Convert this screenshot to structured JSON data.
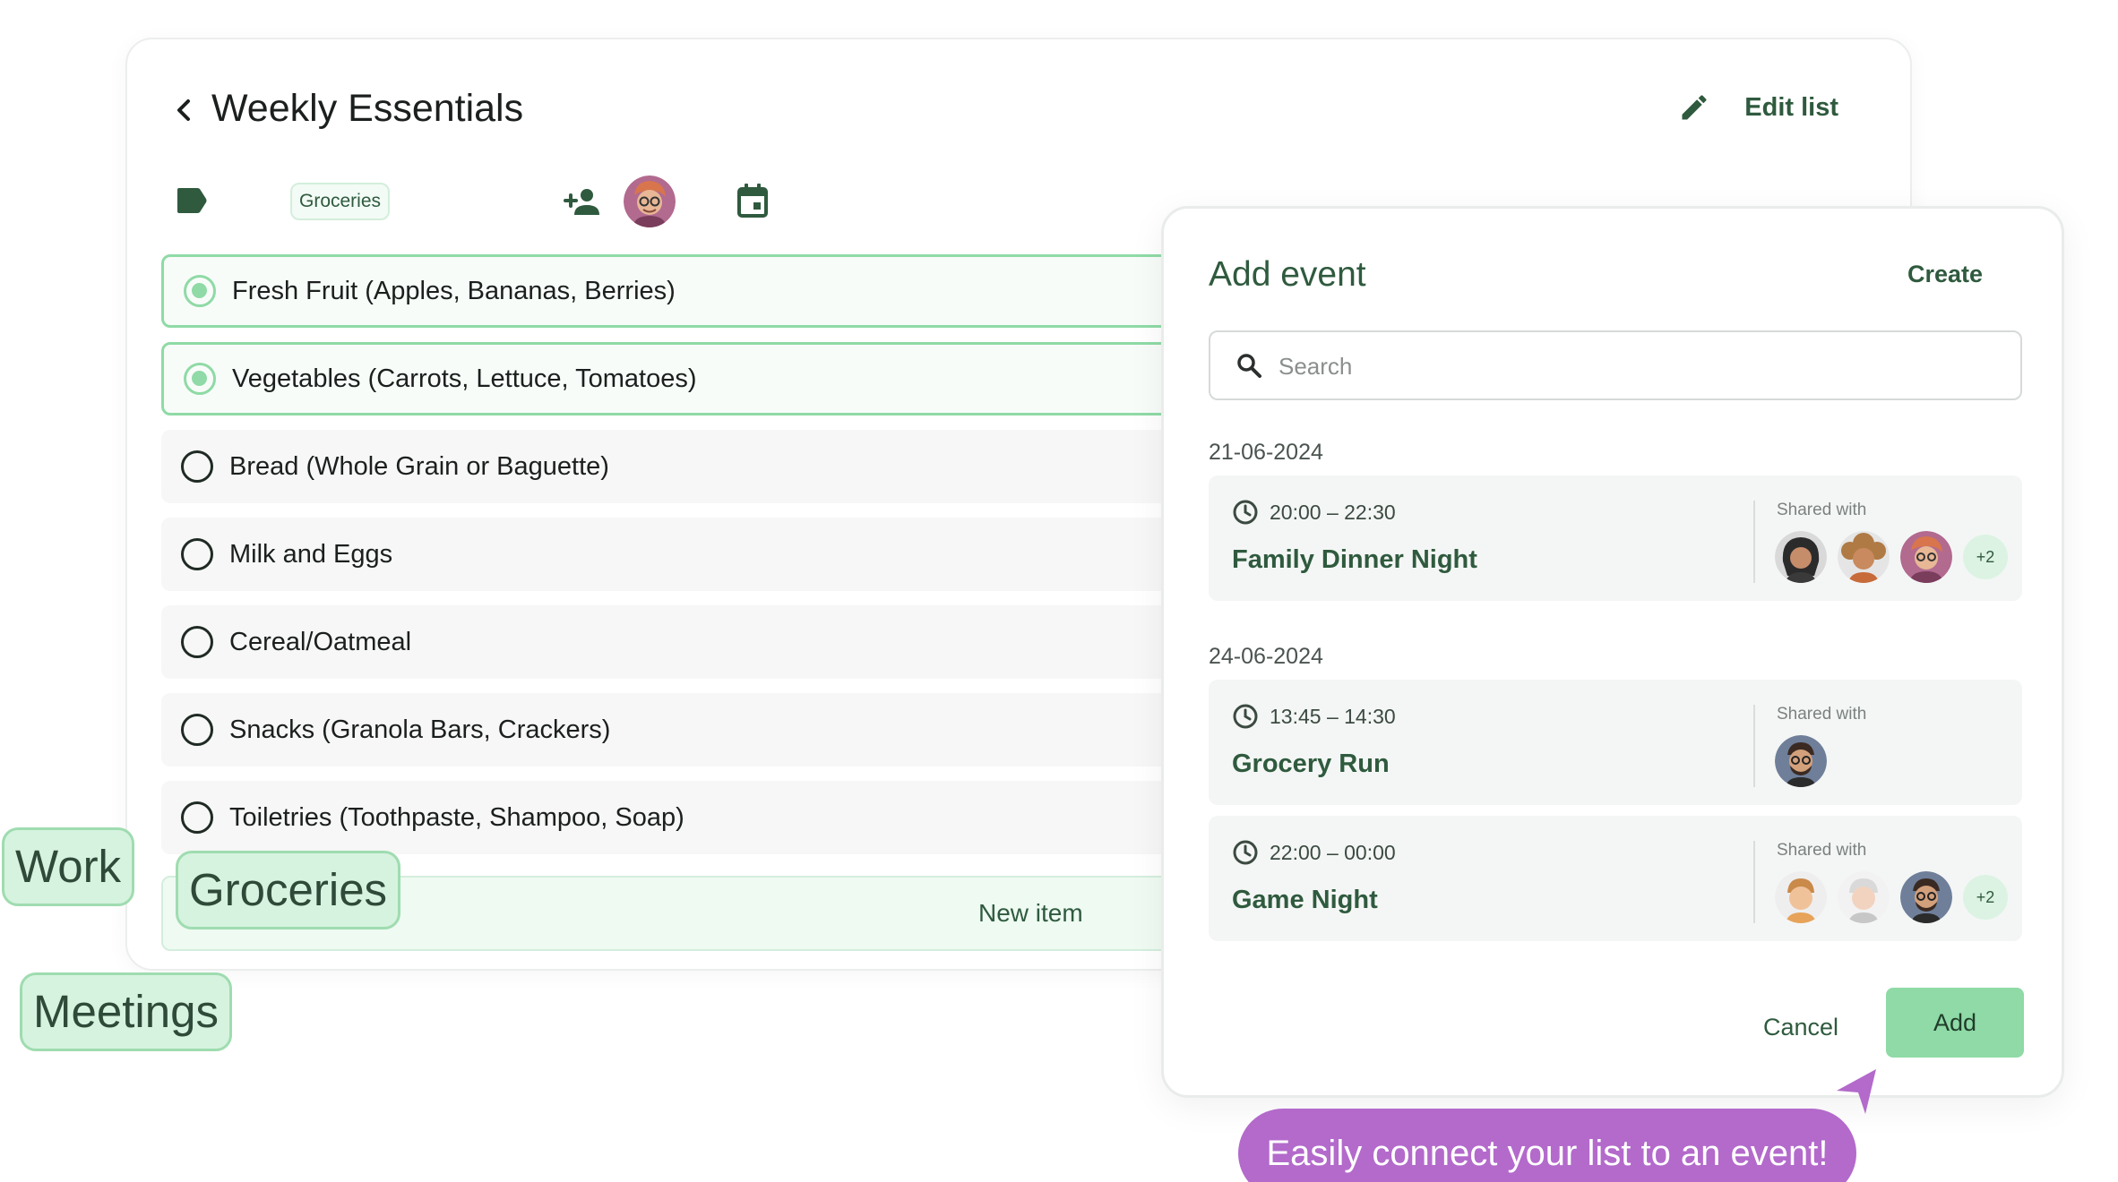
{
  "list": {
    "title": "Weekly Essentials",
    "edit_label": "Edit list",
    "tag": "Groceries",
    "items": [
      {
        "label": "Fresh Fruit (Apples, Bananas, Berries)",
        "checked": true
      },
      {
        "label": "Vegetables (Carrots, Lettuce, Tomatoes)",
        "checked": true
      },
      {
        "label": "Bread (Whole Grain or Baguette)",
        "checked": false
      },
      {
        "label": "Milk and Eggs",
        "checked": false
      },
      {
        "label": "Cereal/Oatmeal",
        "checked": false
      },
      {
        "label": "Snacks (Granola Bars, Crackers)",
        "checked": false
      },
      {
        "label": "Toiletries (Toothpaste, Shampoo, Soap)",
        "checked": false
      }
    ],
    "new_item_label": "New item"
  },
  "floating_tags": {
    "work": "Work",
    "groceries": "Groceries",
    "meetings": "Meetings"
  },
  "panel": {
    "title": "Add event",
    "create_label": "Create",
    "search_placeholder": "Search",
    "groups": [
      {
        "date": "21-06-2024",
        "events": [
          {
            "time": "20:00 – 22:30",
            "name": "Family Dinner Night",
            "shared_label": "Shared with",
            "more": "+2"
          }
        ]
      },
      {
        "date": "24-06-2024",
        "events": [
          {
            "time": "13:45 – 14:30",
            "name": "Grocery Run",
            "shared_label": "Shared with"
          },
          {
            "time": "22:00 – 00:00",
            "name": "Game Night",
            "shared_label": "Shared with",
            "more": "+2"
          }
        ]
      }
    ],
    "cancel_label": "Cancel",
    "add_label": "Add"
  },
  "callout": {
    "text": "Easily connect your list to an event!"
  },
  "colors": {
    "accent": "#8fdaa6",
    "dark_green": "#2f5a3e",
    "chip_bg": "#d6f3df",
    "callout_bg": "#b36acb"
  },
  "icons": [
    "back-icon",
    "pencil-icon",
    "tag-icon",
    "add-person-icon",
    "calendar-icon",
    "search-icon",
    "clock-icon",
    "cursor-arrow-icon"
  ]
}
